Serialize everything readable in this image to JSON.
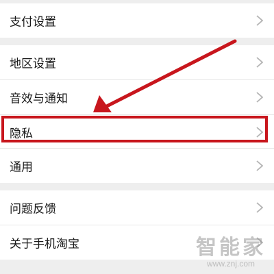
{
  "settings": {
    "items": [
      {
        "label": "支付设置"
      },
      {
        "label": "地区设置"
      },
      {
        "label": "音效与通知"
      },
      {
        "label": "隐私"
      },
      {
        "label": "通用"
      },
      {
        "label": "问题反馈"
      },
      {
        "label": "关于手机淘宝"
      }
    ]
  },
  "annotation": {
    "color": "#c8161d",
    "target": "隐私"
  },
  "watermark": {
    "title": "智能家",
    "url": "www.znj.com"
  },
  "colors": {
    "background": "#eeeeee",
    "row": "#ffffff",
    "text": "#1a1a1a",
    "chevron": "#b5b5b5"
  }
}
